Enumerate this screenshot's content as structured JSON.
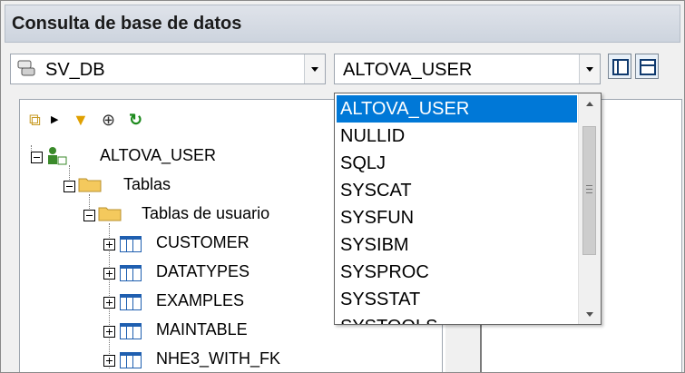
{
  "title": "Consulta de base de datos",
  "datasource": {
    "value": "SV_DB",
    "icon": "database-icon"
  },
  "schema_combo": {
    "value": "ALTOVA_USER"
  },
  "toolbar_buttons": [
    {
      "name": "layout-vertical-icon"
    },
    {
      "name": "layout-horizontal-icon"
    }
  ],
  "tree_toolbar": [
    {
      "name": "add-datasource-icon",
      "glyph": "⧉"
    },
    {
      "name": "filter-icon",
      "glyph": "▼"
    },
    {
      "name": "locate-icon",
      "glyph": "⊕"
    },
    {
      "name": "refresh-icon",
      "glyph": "↻"
    }
  ],
  "tree": {
    "root": "ALTOVA_USER",
    "folder": "Tablas",
    "subfolder": "Tablas de usuario",
    "tables": [
      "CUSTOMER",
      "DATATYPES",
      "EXAMPLES",
      "MAINTABLE",
      "NHE3_WITH_FK"
    ]
  },
  "dropdown": {
    "items": [
      "ALTOVA_USER",
      "NULLID",
      "SQLJ",
      "SYSCAT",
      "SYSFUN",
      "SYSIBM",
      "SYSPROC",
      "SYSSTAT",
      "SYSTOOLS"
    ],
    "selected_index": 0
  },
  "colors": {
    "selection": "#0078d7",
    "table_icon": "#1f5fb0",
    "folder": "#f4c95d",
    "user_icon": "#3a8a2a"
  }
}
